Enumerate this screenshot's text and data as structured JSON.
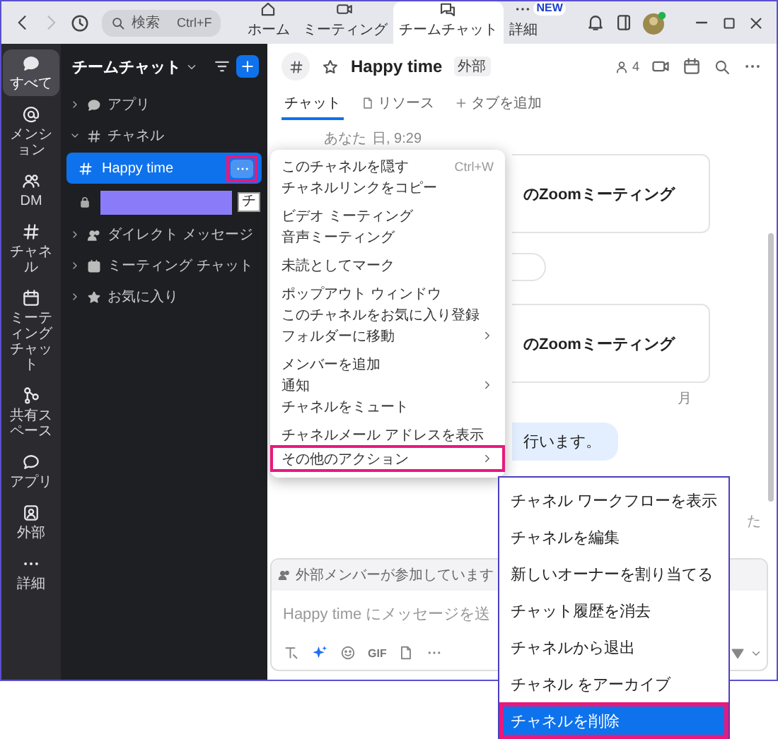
{
  "titlebar": {
    "search": {
      "placeholder": "検索",
      "shortcut": "Ctrl+F"
    },
    "tabs": [
      {
        "kind": "home",
        "label": "ホーム",
        "selected": false
      },
      {
        "kind": "meetings",
        "label": "ミーティング",
        "selected": false
      },
      {
        "kind": "chat",
        "label": "チームチャット",
        "selected": true
      },
      {
        "kind": "more",
        "label": "詳細",
        "selected": false,
        "badge": "NEW"
      }
    ]
  },
  "rail": [
    {
      "kind": "all",
      "label": "すべて",
      "selected": true
    },
    {
      "kind": "mention",
      "label": "メンション",
      "selected": false
    },
    {
      "kind": "dm",
      "label": "DM",
      "selected": false
    },
    {
      "kind": "channel",
      "label": "チャネル",
      "selected": false
    },
    {
      "kind": "meeting",
      "label": "ミーティングチャット",
      "selected": false
    },
    {
      "kind": "spaces",
      "label": "共有スペース",
      "selected": false
    },
    {
      "kind": "apps",
      "label": "アプリ",
      "selected": false
    },
    {
      "kind": "external",
      "label": "外部",
      "selected": false
    },
    {
      "kind": "more",
      "label": "詳細",
      "selected": false
    }
  ],
  "sidebar": {
    "title": "チームチャット",
    "sections": [
      {
        "kind": "apps",
        "label": "アプリ",
        "expanded": false
      },
      {
        "kind": "channels",
        "label": "チャネル",
        "expanded": true,
        "channels": [
          {
            "kind": "public",
            "name": "Happy time",
            "selected": true,
            "more_highlighted": true
          },
          {
            "kind": "private",
            "redacted": true,
            "selected": false,
            "tooltip": "チ"
          }
        ]
      },
      {
        "kind": "dm",
        "label": "ダイレクト メッセージ",
        "expanded": false
      },
      {
        "kind": "meeting",
        "label": "ミーティング チャット",
        "expanded": false
      },
      {
        "kind": "favorites",
        "label": "お気に入り",
        "expanded": false
      }
    ]
  },
  "channel": {
    "name": "Happy time",
    "badge": "外部",
    "members": "4",
    "tabs": [
      {
        "kind": "chat",
        "label": "チャット",
        "selected": true
      },
      {
        "kind": "resources",
        "label": "リソース",
        "selected": false
      },
      {
        "kind": "add",
        "label": "タブを追加",
        "selected": false
      }
    ]
  },
  "messages": {
    "sender": "あなた",
    "time": "日, 9:29",
    "items": [
      {
        "kind": "card",
        "text": "のZoomミーティング"
      },
      {
        "kind": "pill"
      },
      {
        "kind": "card",
        "text": "のZoomミーティング"
      },
      {
        "kind": "date",
        "text": "月"
      },
      {
        "kind": "bubble",
        "text": "行います。"
      },
      {
        "kind": "note",
        "text": "た"
      }
    ]
  },
  "composer": {
    "banner": "外部メンバーが参加しています",
    "placeholder": "Happy time にメッセージを送",
    "gif": "GIF"
  },
  "context_menu": [
    [
      {
        "label": "このチャネルを隠す",
        "shortcut": "Ctrl+W",
        "submenu": false,
        "highlighted": false
      },
      {
        "label": "チャネルリンクをコピー",
        "submenu": false,
        "highlighted": false
      }
    ],
    [
      {
        "label": "ビデオ ミーティング",
        "submenu": false,
        "highlighted": false
      },
      {
        "label": "音声ミーティング",
        "submenu": false,
        "highlighted": false
      }
    ],
    [
      {
        "label": "未読としてマーク",
        "submenu": false,
        "highlighted": false
      }
    ],
    [
      {
        "label": "ポップアウト ウィンドウ",
        "submenu": false,
        "highlighted": false
      },
      {
        "label": "このチャネルをお気に入り登録",
        "submenu": false,
        "highlighted": false
      },
      {
        "label": "フォルダーに移動",
        "submenu": true,
        "highlighted": false
      }
    ],
    [
      {
        "label": "メンバーを追加",
        "submenu": false,
        "highlighted": false
      },
      {
        "label": "通知",
        "submenu": true,
        "highlighted": false
      },
      {
        "label": "チャネルをミュート",
        "submenu": false,
        "highlighted": false
      }
    ],
    [
      {
        "label": "チャネルメール アドレスを表示",
        "submenu": false,
        "highlighted": false
      },
      {
        "label": "その他のアクション",
        "submenu": true,
        "highlighted": true
      }
    ]
  ],
  "submenu": [
    {
      "label": "チャネル ワークフローを表示",
      "selected": false,
      "highlighted": false
    },
    {
      "label": "チャネルを編集",
      "selected": false,
      "highlighted": false
    },
    {
      "label": "新しいオーナーを割り当てる",
      "selected": false,
      "highlighted": false
    },
    {
      "label": "チャット履歴を消去",
      "selected": false,
      "highlighted": false
    },
    {
      "label": "チャネルから退出",
      "selected": false,
      "highlighted": false
    },
    {
      "label": "チャネル をアーカイブ",
      "selected": false,
      "highlighted": false
    },
    {
      "label": "チャネルを削除",
      "selected": true,
      "highlighted": true
    }
  ]
}
